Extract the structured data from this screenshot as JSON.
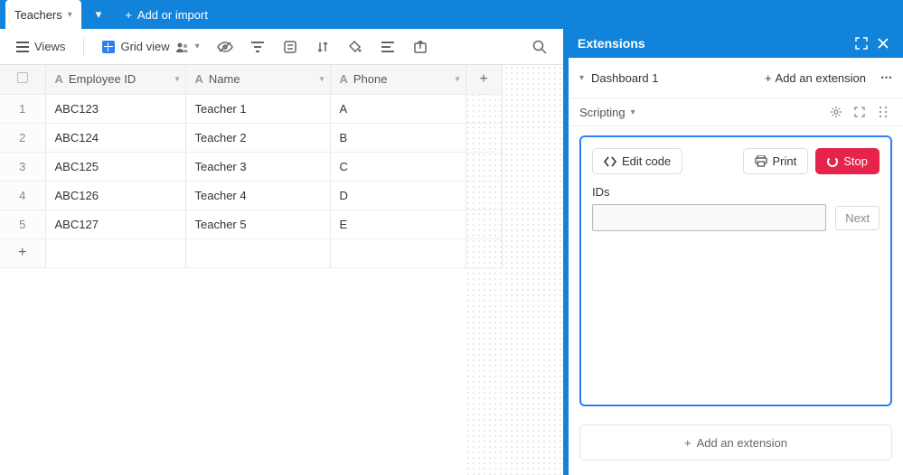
{
  "topbar": {
    "active_tab": "Teachers",
    "add_or_import": "Add or import"
  },
  "extensions_header": {
    "title": "Extensions"
  },
  "toolbar": {
    "views": "Views",
    "grid_view": "Grid view"
  },
  "columns": {
    "employee_id": "Employee ID",
    "name": "Name",
    "phone": "Phone"
  },
  "rows": [
    {
      "num": "1",
      "employee_id": "ABC123",
      "name": "Teacher 1",
      "phone": "A"
    },
    {
      "num": "2",
      "employee_id": "ABC124",
      "name": "Teacher 2",
      "phone": "B"
    },
    {
      "num": "3",
      "employee_id": "ABC125",
      "name": "Teacher 3",
      "phone": "C"
    },
    {
      "num": "4",
      "employee_id": "ABC126",
      "name": "Teacher 4",
      "phone": "D"
    },
    {
      "num": "5",
      "employee_id": "ABC127",
      "name": "Teacher 5",
      "phone": "E"
    }
  ],
  "dashboard": {
    "name": "Dashboard 1",
    "add_extension": "Add an extension"
  },
  "scripting": {
    "title": "Scripting",
    "edit_code": "Edit code",
    "print": "Print",
    "stop": "Stop",
    "input_label": "IDs",
    "next": "Next"
  },
  "footer": {
    "add_extension": "Add an extension"
  }
}
